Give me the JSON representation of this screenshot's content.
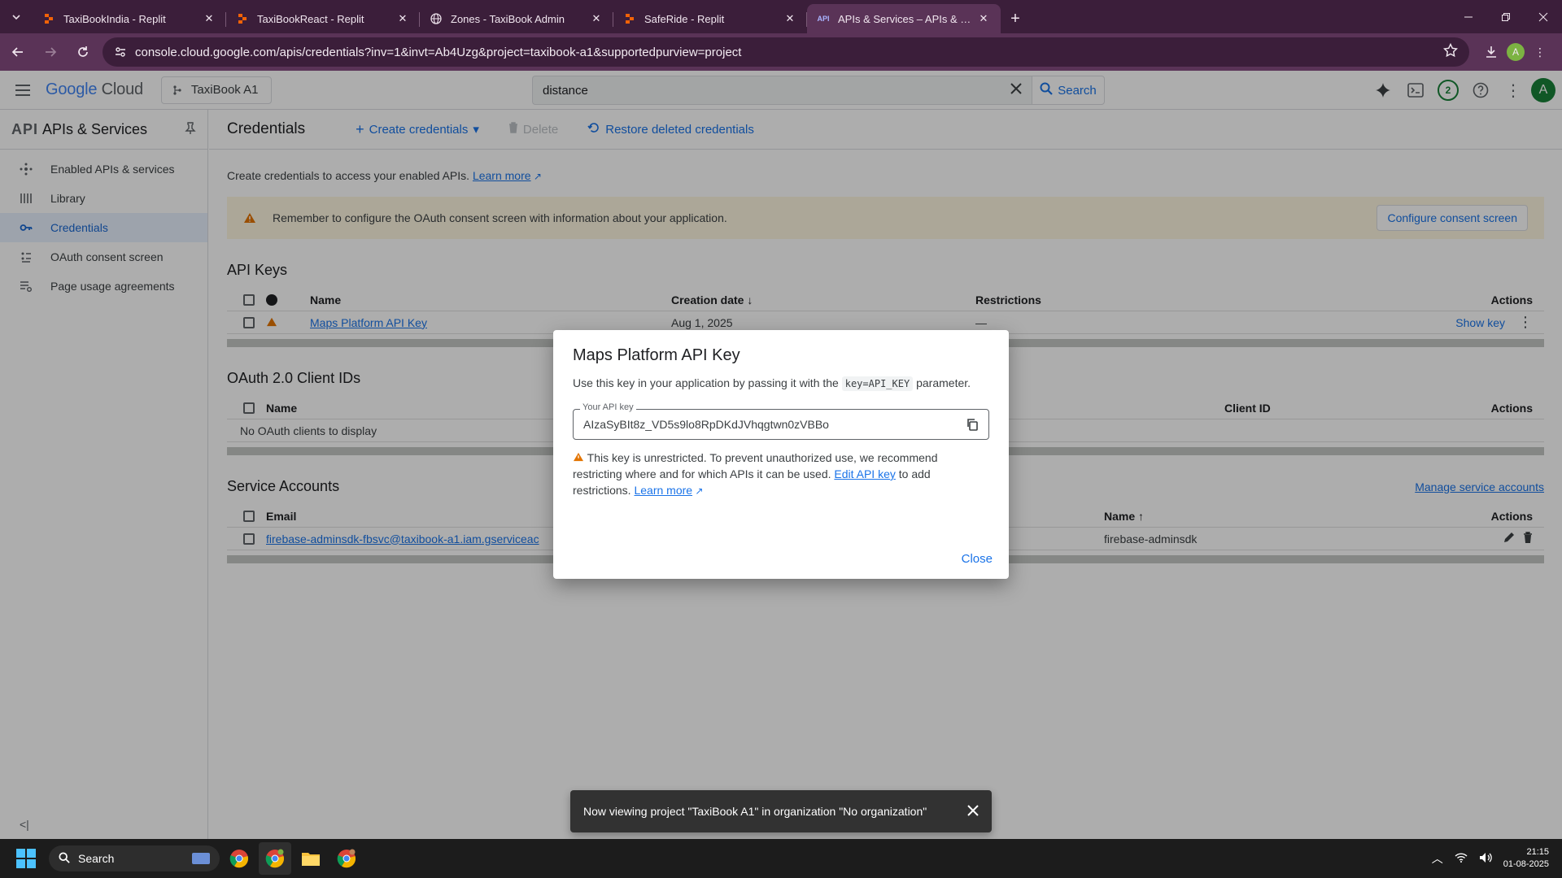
{
  "browser": {
    "tabs": [
      {
        "title": "TaxiBookIndia - Replit",
        "active": false
      },
      {
        "title": "TaxiBookReact - Replit",
        "active": false
      },
      {
        "title": "Zones - TaxiBook Admin",
        "active": false
      },
      {
        "title": "SafeRide - Replit",
        "active": false
      },
      {
        "title": "APIs & Services – APIs & Servic",
        "active": true
      }
    ],
    "url": "console.cloud.google.com/apis/credentials?inv=1&invt=Ab4Uzg&project=taxibook-a1&supportedpurview=project",
    "profile_initial": "A"
  },
  "header": {
    "logo_google": "Google",
    "logo_cloud": "Cloud",
    "project": "TaxiBook A1",
    "search_value": "distance",
    "search_button": "Search",
    "notifications": "2",
    "avatar": "A"
  },
  "sidebar": {
    "title": "APIs & Services",
    "logo_text": "API",
    "items": [
      {
        "label": "Enabled APIs & services",
        "icon": "hub-icon"
      },
      {
        "label": "Library",
        "icon": "library-icon"
      },
      {
        "label": "Credentials",
        "icon": "key-icon",
        "active": true
      },
      {
        "label": "OAuth consent screen",
        "icon": "consent-icon"
      },
      {
        "label": "Page usage agreements",
        "icon": "settings-list-icon"
      }
    ]
  },
  "actionbar": {
    "title": "Credentials",
    "create": "Create credentials",
    "delete": "Delete",
    "restore": "Restore deleted credentials"
  },
  "content": {
    "intro": "Create credentials to access your enabled APIs.",
    "learn_more": "Learn more",
    "banner_text": "Remember to configure the OAuth consent screen with information about your application.",
    "banner_button": "Configure consent screen"
  },
  "api_keys": {
    "title": "API Keys",
    "columns": {
      "name": "Name",
      "created": "Creation date",
      "restrictions": "Restrictions",
      "actions": "Actions"
    },
    "rows": [
      {
        "name": "Maps Platform API Key",
        "created": "Aug 1, 2025",
        "restrictions": "—",
        "action": "Show key"
      }
    ]
  },
  "oauth": {
    "title": "OAuth 2.0 Client IDs",
    "columns": {
      "name": "Name",
      "client_id": "Client ID",
      "actions": "Actions"
    },
    "empty": "No OAuth clients to display"
  },
  "service_accounts": {
    "title": "Service Accounts",
    "manage": "Manage service accounts",
    "columns": {
      "email": "Email",
      "name": "Name",
      "actions": "Actions"
    },
    "rows": [
      {
        "email": "firebase-adminsdk-fbsvc@taxibook-a1.iam.gserviceac",
        "name": "firebase-adminsdk"
      }
    ]
  },
  "dialog": {
    "title": "Maps Platform API Key",
    "desc_before": "Use this key in your application by passing it with the ",
    "desc_code": "key=API_KEY",
    "desc_after": " parameter.",
    "field_label": "Your API key",
    "key_value": "AIzaSyBIt8z_VD5s9lo8RpDKdJVhqgtwn0zVBBo",
    "warn_text": "This key is unrestricted. To prevent unauthorized use, we recommend restricting where and for which APIs it can be used.",
    "edit_link": "Edit API key",
    "warn_after": " to add restrictions.",
    "learn_more": "Learn more",
    "close": "Close"
  },
  "snackbar": {
    "text": "Now viewing project \"TaxiBook A1\" in organization \"No organization\""
  },
  "taskbar": {
    "search": "Search",
    "time": "21:15",
    "date": "01-08-2025"
  }
}
